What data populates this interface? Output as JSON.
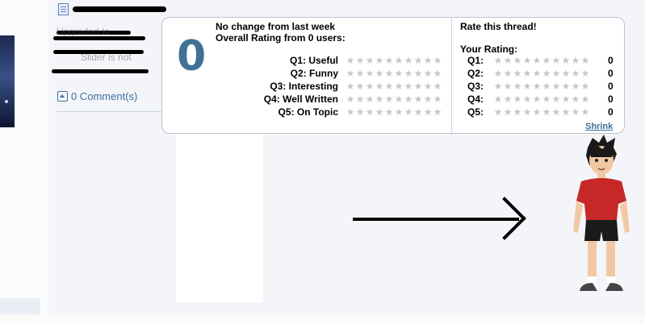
{
  "sidebar": {
    "thumbnail_alt": ""
  },
  "post": {
    "comment_link": "0 Comment(s)",
    "blurred_line_1": "Upgraded to",
    "blurred_line_2": "Slider is not"
  },
  "rating_popup": {
    "overall_score": "0",
    "change_text": "No change from last week",
    "overall_text": "Overall Rating from 0 users:",
    "questions": [
      {
        "label": "Q1: Useful"
      },
      {
        "label": "Q2: Funny"
      },
      {
        "label": "Q3: Interesting"
      },
      {
        "label": "Q4: Well Written"
      },
      {
        "label": "Q5: On Topic"
      }
    ],
    "rate_title": "Rate this thread!",
    "your_rating_label": "Your Rating:",
    "your_rating": [
      {
        "label": "Q1:",
        "value": "0"
      },
      {
        "label": "Q2:",
        "value": "0"
      },
      {
        "label": "Q3:",
        "value": "0"
      },
      {
        "label": "Q4:",
        "value": "0"
      },
      {
        "label": "Q5:",
        "value": "0"
      }
    ],
    "shrink_label": "Shrink",
    "stars_per_row": 10,
    "star_color": "#c7c7c7",
    "score_color": "#3f7196"
  },
  "colors": {
    "link": "#3d6fa0",
    "avatar_shirt": "#c62828",
    "avatar_shorts": "#1a1a1a",
    "arrow": "#000000"
  }
}
